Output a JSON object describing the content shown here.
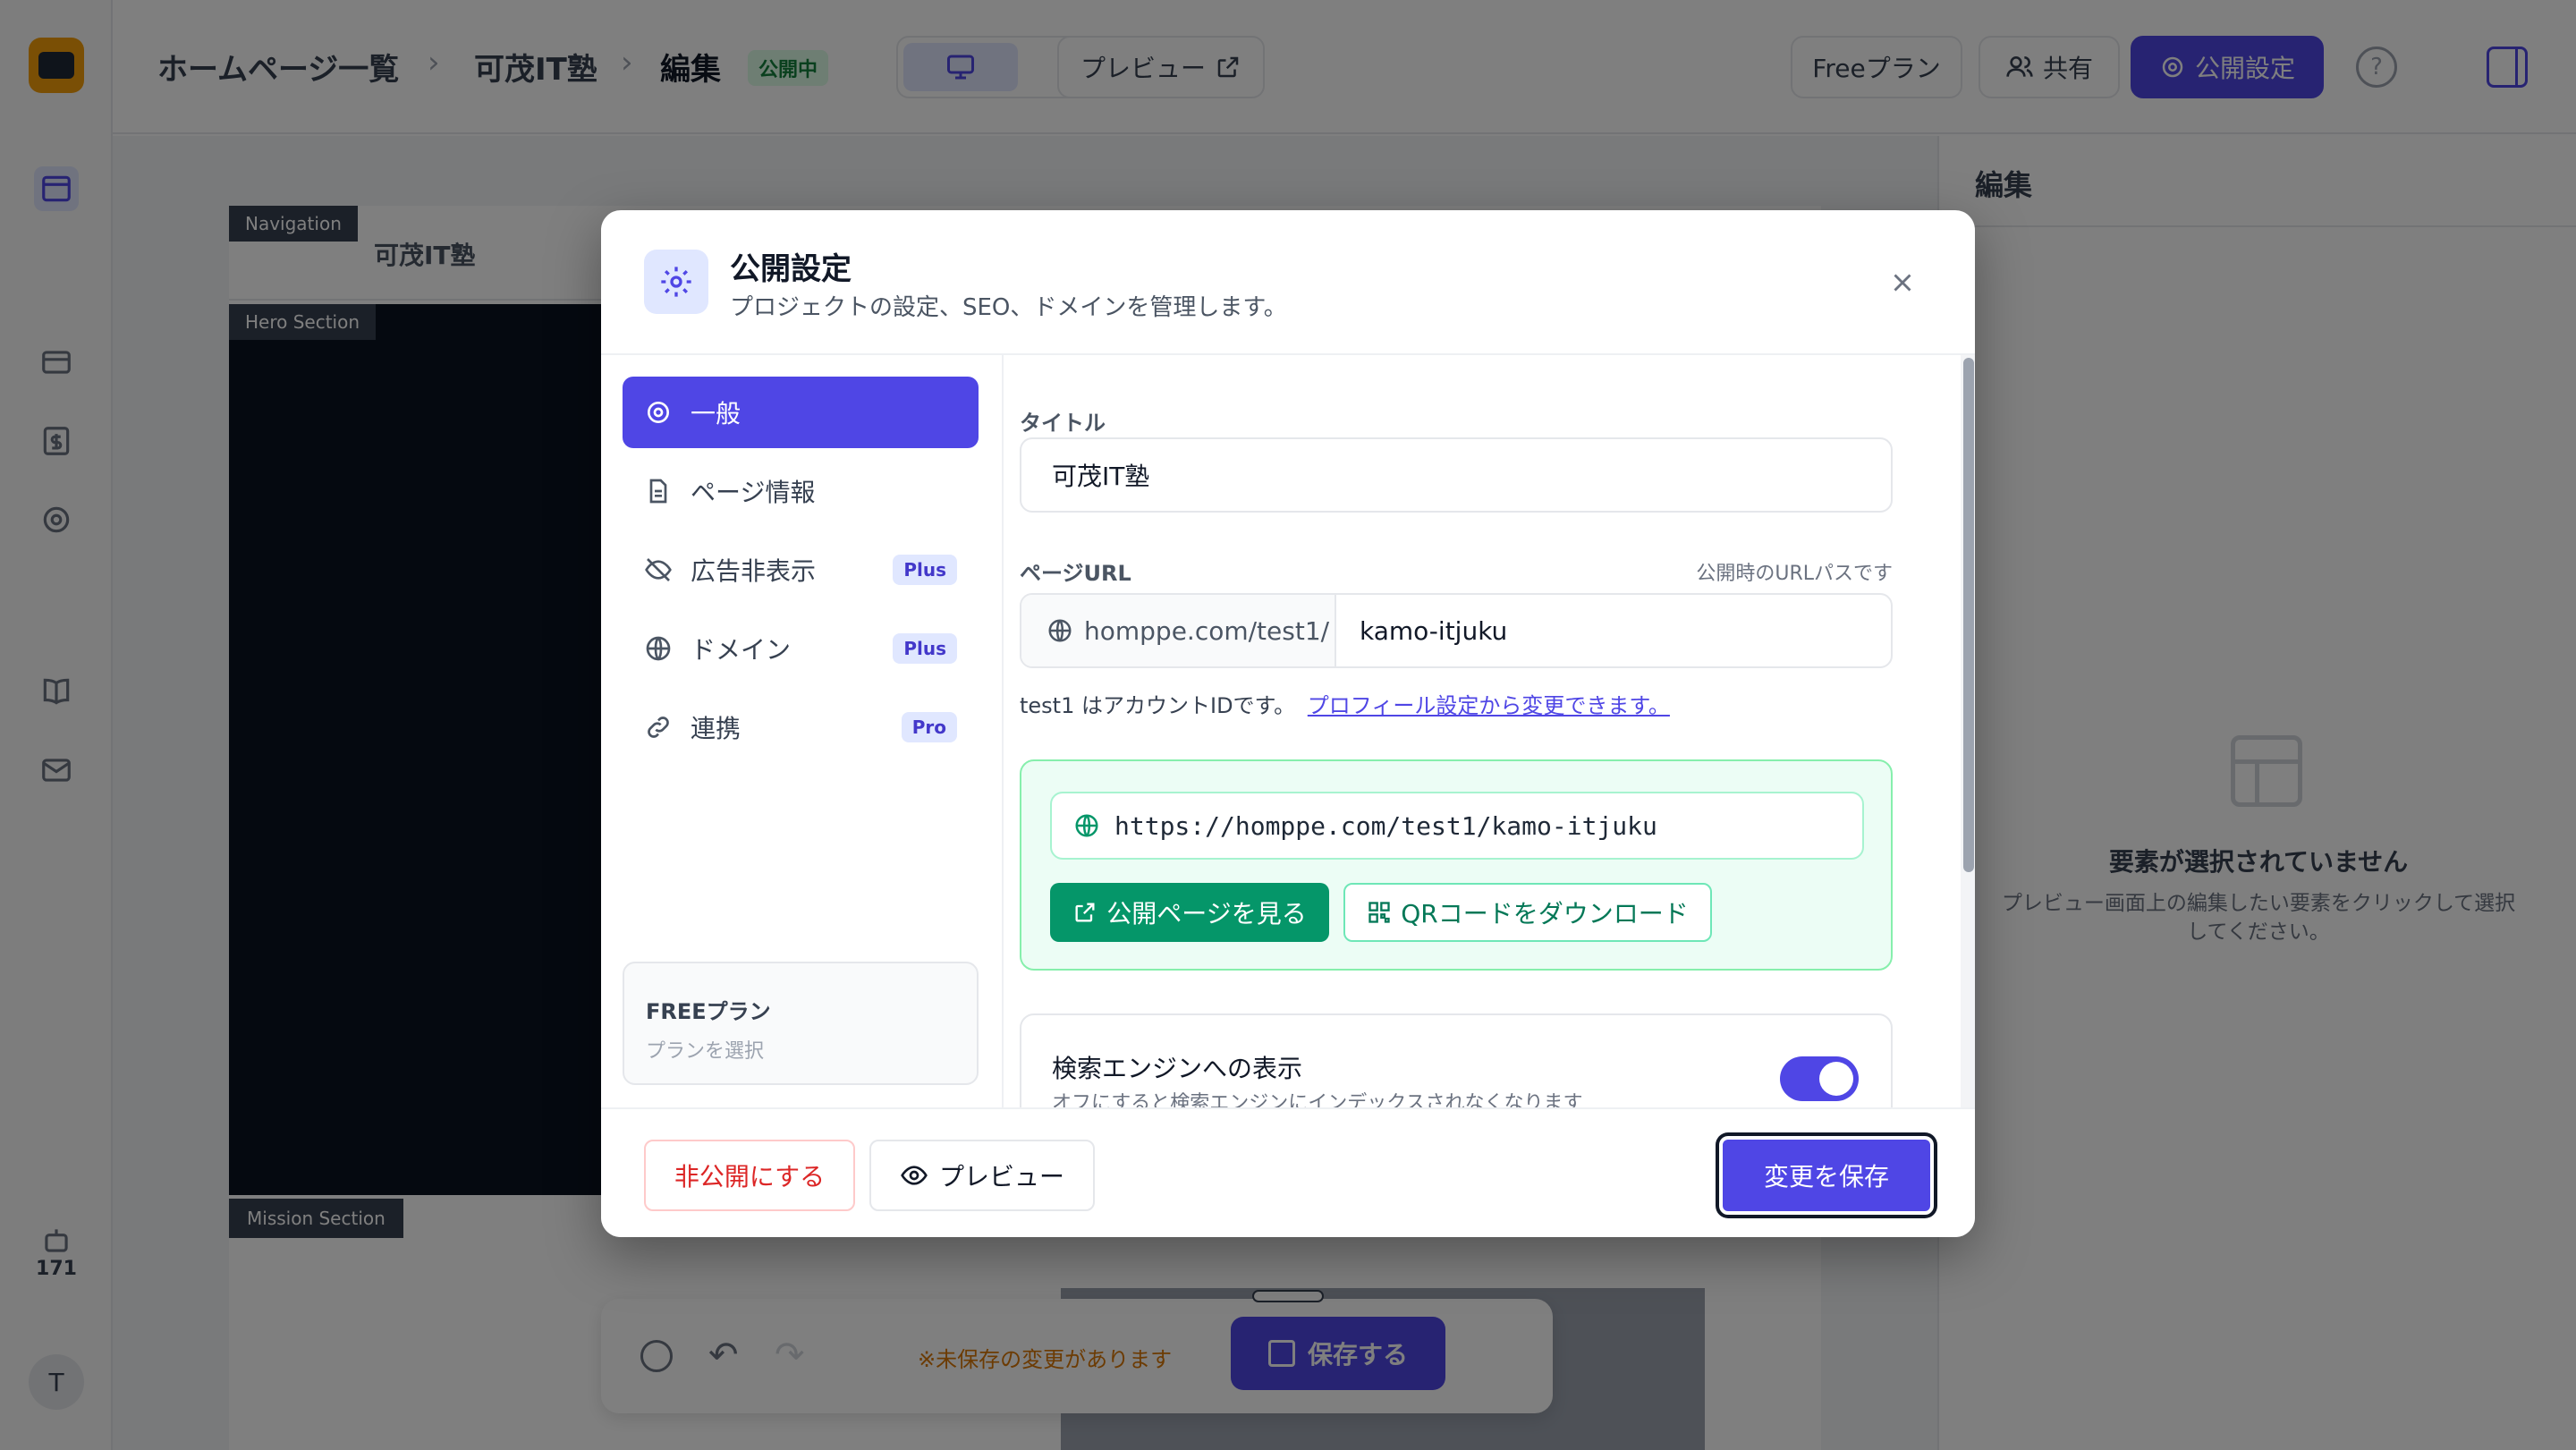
{
  "topbar": {
    "breadcrumb": [
      "ホームページ一覧",
      "可茂IT塾",
      "編集"
    ],
    "status_badge": "公開中",
    "preview_label": "プレビュー",
    "plan_label": "Freeプラン",
    "share_label": "共有",
    "publish_settings_label": "公開設定"
  },
  "sidebar": {
    "counter": "171",
    "avatar": "T"
  },
  "canvas": {
    "sections": [
      "Navigation",
      "Hero Section",
      "Mission Section"
    ],
    "nav_logo_text": "可茂IT塾",
    "unsaved_text": "※未保存の変更があります",
    "save_label": "保存する"
  },
  "right_panel": {
    "title": "編集",
    "empty_title": "要素が選択されていません",
    "empty_desc": "プレビュー画面上の編集したい要素をクリックして選択してください。"
  },
  "modal": {
    "title": "公開設定",
    "subtitle": "プロジェクトの設定、SEO、ドメインを管理します。",
    "nav": [
      {
        "label": "一般",
        "badge": "",
        "icon": "gear-icon"
      },
      {
        "label": "ページ情報",
        "badge": "",
        "icon": "document-icon"
      },
      {
        "label": "広告非表示",
        "badge": "Plus",
        "icon": "eye-off-icon"
      },
      {
        "label": "ドメイン",
        "badge": "Plus",
        "icon": "globe-icon"
      },
      {
        "label": "連携",
        "badge": "Pro",
        "icon": "link-icon"
      }
    ],
    "plan_box": {
      "title": "FREEプラン",
      "subtitle": "プランを選択"
    },
    "form": {
      "title_label": "タイトル",
      "title_value": "可茂IT塾",
      "url_label": "ページURL",
      "url_hint": "公開時のURLパスです",
      "url_prefix": "homppe.com/test1/",
      "url_slug": "kamo-itjuku",
      "account_note": "test1 はアカウントIDです。",
      "profile_link": "プロフィール設定から変更できます。",
      "full_url": "https://homppe.com/test1/kamo-itjuku",
      "view_page_label": "公開ページを見る",
      "qr_label": "QRコードをダウンロード",
      "seo_title": "検索エンジンへの表示",
      "seo_desc": "オフにすると検索エンジンにインデックスされなくなります",
      "seo_enabled": true
    },
    "footer": {
      "unpublish_label": "非公開にする",
      "preview_label": "プレビュー",
      "save_label": "変更を保存"
    }
  },
  "colors": {
    "accent": "#4f46e5",
    "success": "#059669",
    "danger": "#dc2626"
  }
}
